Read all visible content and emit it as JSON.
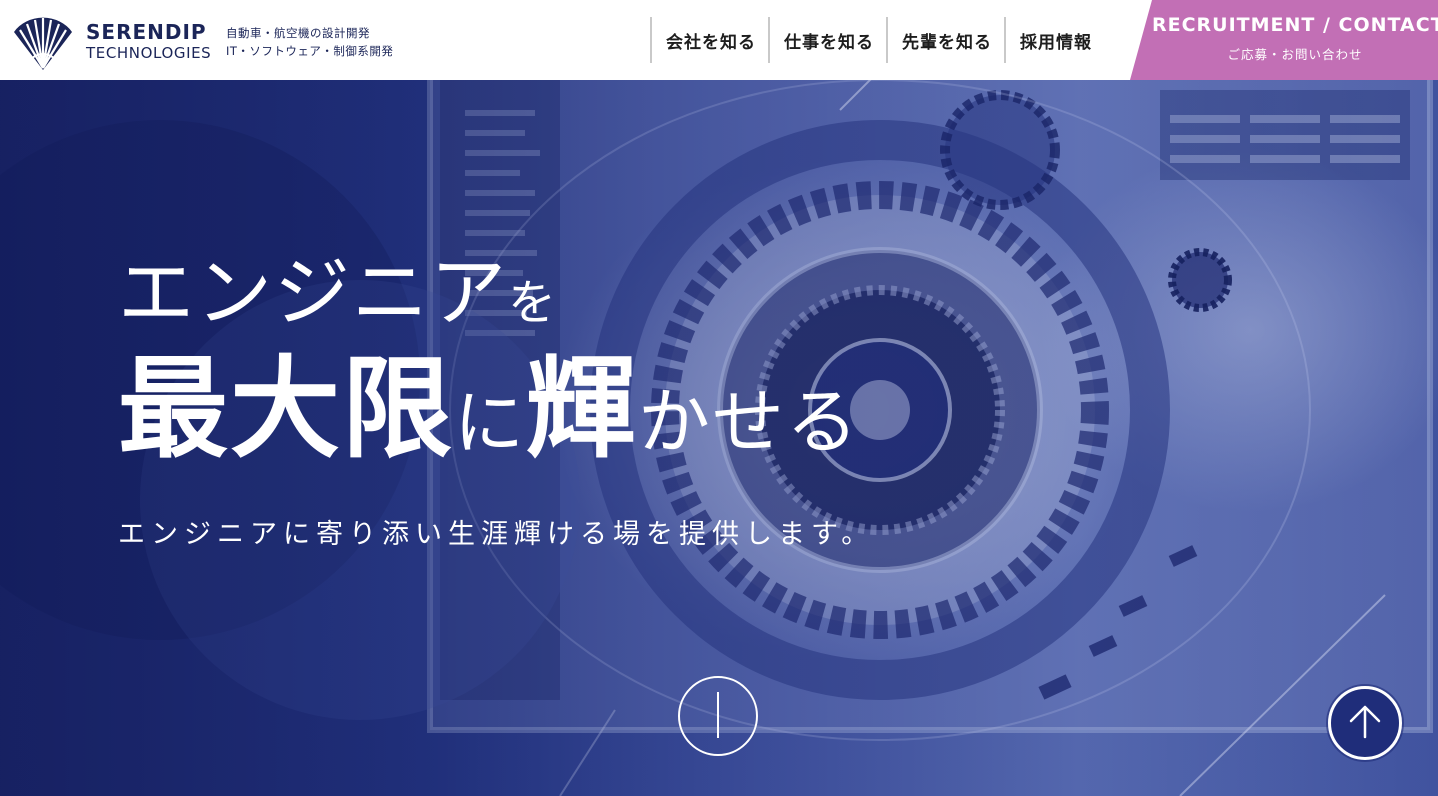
{
  "brand": {
    "name": "SERENDIP",
    "sub": "TECHNOLOGIES",
    "tagline_1": "自動車・航空機の設計開発",
    "tagline_2": "IT・ソフトウェア・制御系開発"
  },
  "nav": {
    "items": [
      {
        "label": "会社を知る"
      },
      {
        "label": "仕事を知る"
      },
      {
        "label": "先輩を知る"
      },
      {
        "label": "採用情報"
      }
    ]
  },
  "cta": {
    "title": "RECRUITMENT / CONTACT",
    "subtitle": "ご応募・お問い合わせ",
    "color": "#c26fb5"
  },
  "hero": {
    "line1_main": "エンジニア",
    "line1_small": "を",
    "line2_a": "最大限",
    "line2_b": "に",
    "line2_c": "輝",
    "line2_d": "かせる",
    "subline": "エンジニアに寄り添い生涯輝ける場を提供します。"
  },
  "colors": {
    "brand_navy": "#1b2558",
    "hero_blue": "#243583",
    "accent_pink": "#c26fb5"
  },
  "icons": {
    "logo": "logo-fan-icon",
    "scroll": "scroll-down-icon",
    "pagetop": "arrow-up-icon"
  }
}
